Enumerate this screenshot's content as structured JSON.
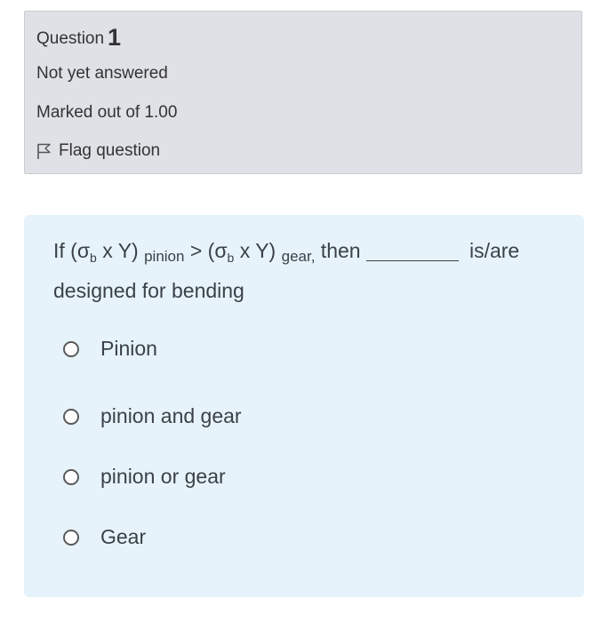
{
  "info": {
    "question_word": "Question",
    "question_number": "1",
    "state": "Not yet answered",
    "grade": "Marked out of 1.00",
    "flag_label": "Flag question"
  },
  "question": {
    "part1": "If (σ",
    "sub_b1": "b",
    "part2": " x Y) ",
    "sub_pinion": "pinion",
    "part3": " > (σ",
    "sub_b2": "b",
    "part4": " x Y) ",
    "sub_gear": "gear,",
    "part5": " then",
    "part6": " is/are designed for bending"
  },
  "options": [
    {
      "label": "Pinion"
    },
    {
      "label": "pinion and gear"
    },
    {
      "label": "pinion or gear"
    },
    {
      "label": "Gear"
    }
  ]
}
